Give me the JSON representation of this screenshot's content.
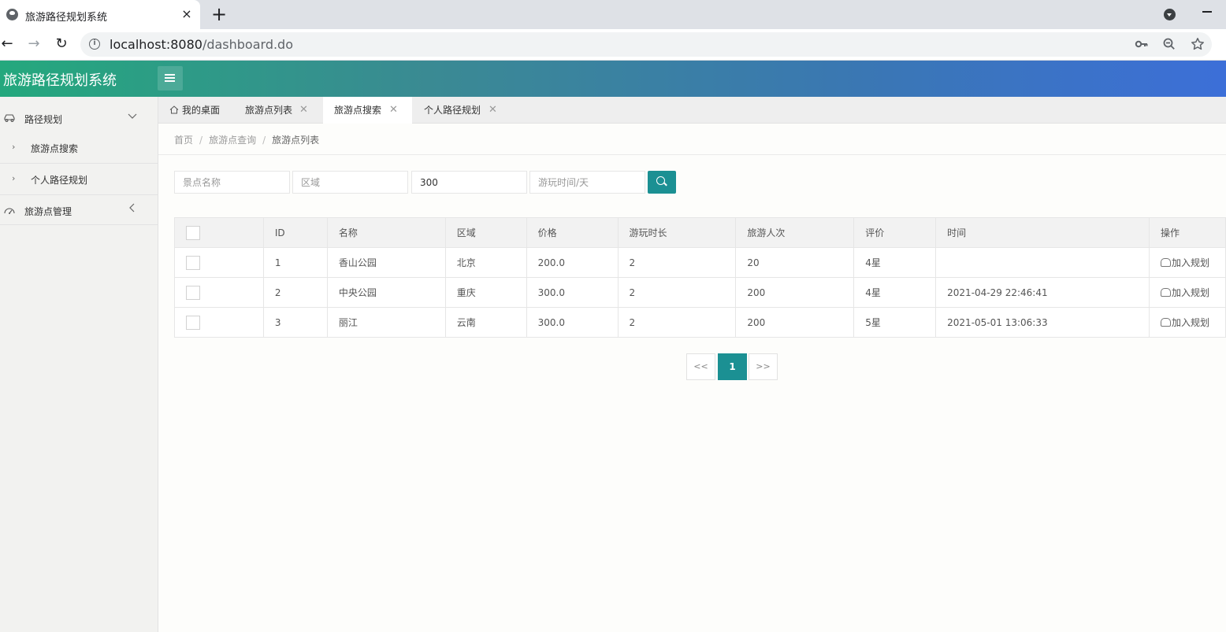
{
  "browser": {
    "tab_title": "旅游路径规划系统",
    "tab_close": "×",
    "new_tab": "+",
    "url_host": "localhost:8080",
    "url_path": "/dashboard.do"
  },
  "header": {
    "title": "旅游路径规划系统"
  },
  "sidebar": {
    "groups": [
      {
        "label": "路径规划",
        "icon": "car-icon",
        "expanded": true,
        "items": [
          {
            "label": "旅游点搜索"
          },
          {
            "label": "个人路径规划"
          }
        ]
      },
      {
        "label": "旅游点管理",
        "icon": "dashboard-icon",
        "expanded": false
      }
    ]
  },
  "page_tabs": [
    {
      "label": "我的桌面",
      "icon": "home-icon",
      "closable": false
    },
    {
      "label": "旅游点列表",
      "closable": true
    },
    {
      "label": "旅游点搜索",
      "closable": true,
      "active": true
    },
    {
      "label": "个人路径规划",
      "closable": true
    }
  ],
  "breadcrumb": {
    "items": [
      "首页",
      "旅游点查询",
      "旅游点列表"
    ],
    "separator": "/"
  },
  "filters": {
    "name_placeholder": "景点名称",
    "region_placeholder": "区域",
    "price_value": "300",
    "duration_placeholder": "游玩时间/天"
  },
  "table": {
    "columns": [
      "ID",
      "名称",
      "区域",
      "价格",
      "游玩时长",
      "旅游人次",
      "评价",
      "时间",
      "操作"
    ],
    "rows": [
      {
        "id": "1",
        "name": "香山公园",
        "region": "北京",
        "price": "200.0",
        "duration": "2",
        "visits": "20",
        "rating": "4星",
        "time": "",
        "action": "加入规划"
      },
      {
        "id": "2",
        "name": "中央公园",
        "region": "重庆",
        "price": "300.0",
        "duration": "2",
        "visits": "200",
        "rating": "4星",
        "time": "2021-04-29 22:46:41",
        "action": "加入规划"
      },
      {
        "id": "3",
        "name": "丽江",
        "region": "云南",
        "price": "300.0",
        "duration": "2",
        "visits": "200",
        "rating": "5星",
        "time": "2021-05-01 13:06:33",
        "action": "加入规划"
      }
    ]
  },
  "pagination": {
    "prev": "<<",
    "current": "1",
    "next": ">>"
  },
  "colors": {
    "accent": "#1b9093",
    "header_start": "#24a87d",
    "header_end": "#3c6fd8"
  }
}
